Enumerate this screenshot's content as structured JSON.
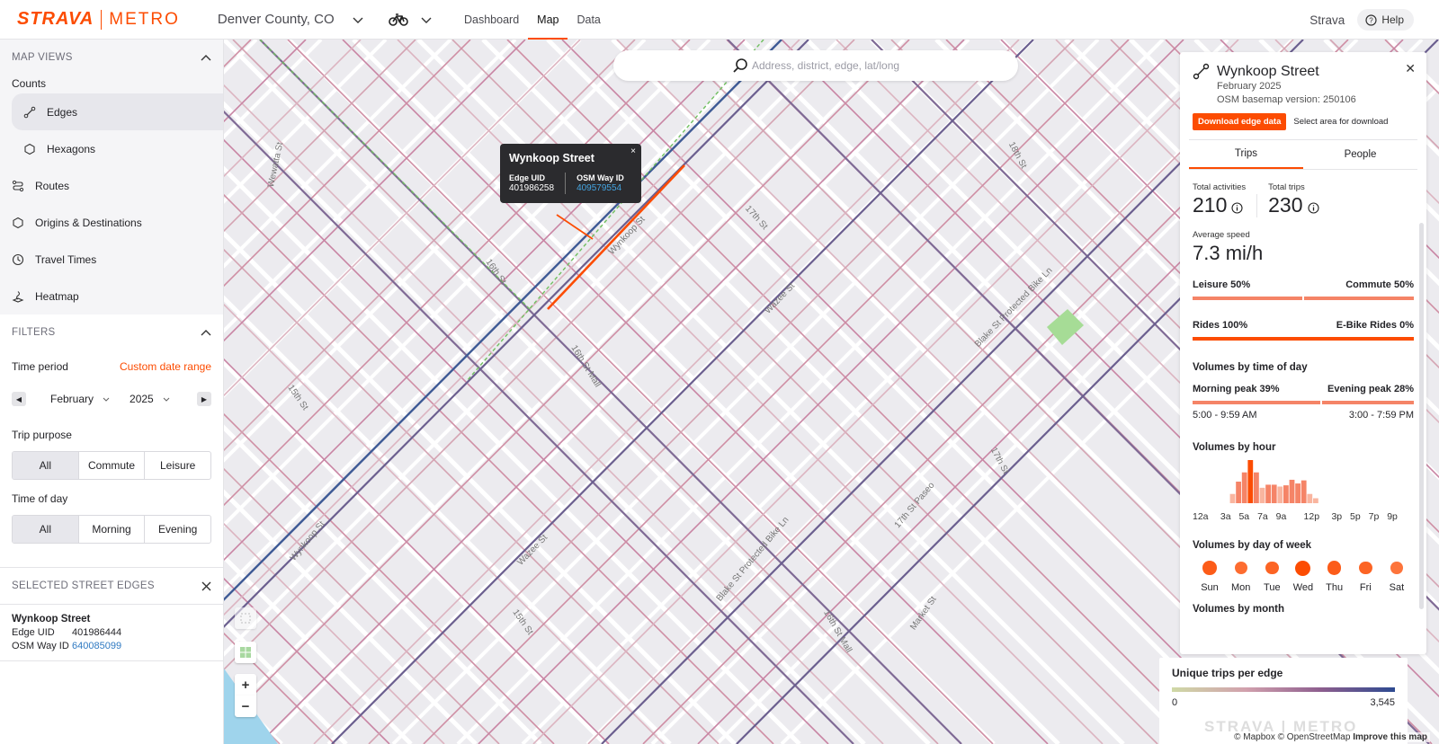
{
  "topbar": {
    "brand_strava": "STRAVA",
    "brand_metro": "METRO",
    "region": "Denver County, CO",
    "nav": [
      {
        "label": "Dashboard",
        "active": false
      },
      {
        "label": "Map",
        "active": true
      },
      {
        "label": "Data",
        "active": false
      }
    ],
    "strava_link": "Strava",
    "help": "Help"
  },
  "sidebar": {
    "map_views_heading": "MAP VIEWS",
    "counts_label": "Counts",
    "views": [
      {
        "label": "Edges",
        "icon": "edge-icon",
        "active": true,
        "sub": true
      },
      {
        "label": "Hexagons",
        "icon": "hexagon-icon",
        "active": false,
        "sub": true
      },
      {
        "label": "Routes",
        "icon": "routes-icon",
        "active": false,
        "sub": false
      },
      {
        "label": "Origins & Destinations",
        "icon": "od-icon",
        "active": false,
        "sub": false
      },
      {
        "label": "Travel Times",
        "icon": "clock-icon",
        "active": false,
        "sub": false
      },
      {
        "label": "Heatmap",
        "icon": "heatmap-icon",
        "active": false,
        "sub": false
      }
    ],
    "filters_heading": "FILTERS",
    "time_period_label": "Time period",
    "custom_range": "Custom date range",
    "month": "February",
    "year": "2025",
    "trip_purpose_label": "Trip purpose",
    "trip_purpose": [
      "All",
      "Commute",
      "Leisure"
    ],
    "time_of_day_label": "Time of day",
    "time_of_day": [
      "All",
      "Morning",
      "Evening"
    ],
    "selected_heading": "SELECTED STREET EDGES",
    "selected": {
      "name": "Wynkoop Street",
      "edge_uid_label": "Edge UID",
      "edge_uid": "401986444",
      "osm_label": "OSM Way ID",
      "osm_id": "640085099"
    }
  },
  "map": {
    "search_placeholder": "Address, district, edge, lat/long",
    "tooltip": {
      "title": "Wynkoop Street",
      "edge_uid_label": "Edge UID",
      "edge_uid": "401986258",
      "osm_label": "OSM Way ID",
      "osm_id": "409579554",
      "close": "×"
    },
    "street_labels": [
      "Wewatta St",
      "16th St",
      "Wynkoop St",
      "17th St",
      "18th St",
      "Wazee St",
      "Blake St Protected Bike Ln",
      "16th St Mall",
      "15th St",
      "Wynkoop St",
      "Wazee St",
      "Blake St Protected Bike Ln",
      "17th St Paseo",
      "17th St",
      "15th St",
      "16th St Mall",
      "Market St",
      "17th Street Plaza"
    ],
    "zoom_in": "+",
    "zoom_out": "−",
    "attribution_mapbox": "© Mapbox",
    "attribution_osm": "© OpenStreetMap",
    "attribution_improve": "Improve this map",
    "legend": {
      "title": "Unique trips per edge",
      "min": "0",
      "max": "3,545",
      "watermark": "STRAVA | METRO"
    }
  },
  "panel": {
    "title": "Wynkoop Street",
    "month": "February 2025",
    "basemap": "OSM basemap version: 250106",
    "download": "Download edge data",
    "select_area": "Select area for download",
    "tabs": [
      {
        "label": "Trips",
        "active": true
      },
      {
        "label": "People",
        "active": false
      }
    ],
    "total_activities_label": "Total activities",
    "total_activities": "210",
    "total_trips_label": "Total trips",
    "total_trips": "230",
    "avg_speed_label": "Average speed",
    "avg_speed": "7.3 mi/h",
    "leisure_label": "Leisure 50%",
    "commute_label": "Commute 50%",
    "leisure_pct": 50,
    "rides_label": "Rides 100%",
    "ebike_label": "E-Bike Rides 0%",
    "rides_pct": 100,
    "tod_title": "Volumes by time of day",
    "morning_label": "Morning peak 39%",
    "evening_label": "Evening peak 28%",
    "morning_pct": 39,
    "evening_pct": 28,
    "morning_time": "5:00 - 9:59 AM",
    "evening_time": "3:00 - 7:59 PM",
    "hour_title": "Volumes by hour",
    "hour_values": [
      0,
      0,
      0,
      0,
      0,
      0,
      1.5,
      3.5,
      5.0,
      7.0,
      5.0,
      2.5,
      3.0,
      3.0,
      2.7,
      2.9,
      3.8,
      3.2,
      3.7,
      1.5,
      0.8,
      0,
      0,
      0
    ],
    "hour_ticks": [
      "12a",
      "3a",
      "5a",
      "7a",
      "9a",
      "12p",
      "3p",
      "5p",
      "7p",
      "9p"
    ],
    "hour_tick_positions": [
      0,
      3,
      5,
      7,
      9,
      12,
      15,
      17,
      19,
      21
    ],
    "dow_title": "Volumes by day of week",
    "dow": [
      {
        "label": "Sun",
        "value": 0.8
      },
      {
        "label": "Mon",
        "value": 0.6
      },
      {
        "label": "Tue",
        "value": 0.7
      },
      {
        "label": "Wed",
        "value": 1.0
      },
      {
        "label": "Thu",
        "value": 0.8
      },
      {
        "label": "Fri",
        "value": 0.7
      },
      {
        "label": "Sat",
        "value": 0.5
      }
    ],
    "month_title": "Volumes by month"
  },
  "colors": {
    "accent": "#fc4c02",
    "accent_light": "#f58467",
    "link": "#2f7ac2"
  }
}
